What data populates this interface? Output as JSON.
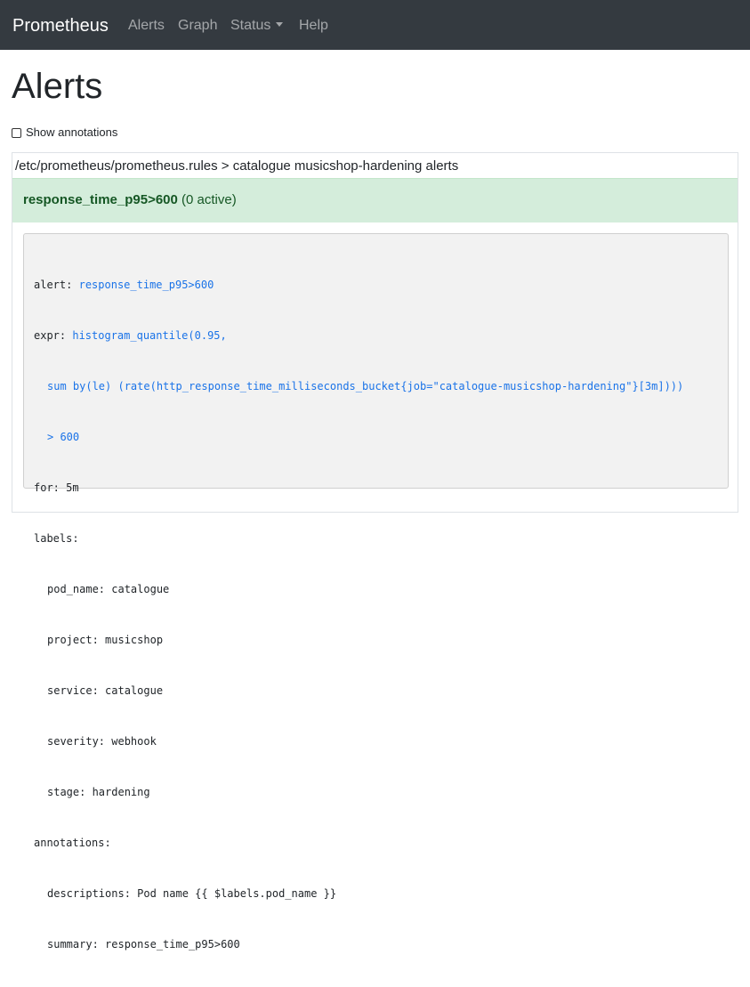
{
  "navbar": {
    "brand": "Prometheus",
    "items": [
      {
        "label": "Alerts"
      },
      {
        "label": "Graph"
      },
      {
        "label": "Status"
      },
      {
        "label": "Help"
      }
    ]
  },
  "page": {
    "title": "Alerts",
    "show_annotations_label": "Show annotations",
    "show_annotations_checked": false
  },
  "group": {
    "header": "/etc/prometheus/prometheus.rules > catalogue musicshop-hardening alerts",
    "alert": {
      "name": "response_time_p95>600",
      "status": "(0 active)",
      "status_color": "#d4eddb"
    },
    "rule": {
      "alert_key": "alert:",
      "alert_value": "response_time_p95>600",
      "expr_key": "expr:",
      "expr_line1": "histogram_quantile(0.95,",
      "expr_line2": "sum by(le) (rate(http_response_time_milliseconds_bucket{job=\"catalogue-musicshop-hardening\"}[3m])))",
      "expr_line3": "> 600",
      "for_line": "for: 5m",
      "labels_key": "labels:",
      "labels": [
        "pod_name: catalogue",
        "project: musicshop",
        "service: catalogue",
        "severity: webhook",
        "stage: hardening"
      ],
      "annotations_key": "annotations:",
      "annotations": [
        "descriptions: Pod name {{ $labels.pod_name }}",
        "summary: response_time_p95>600"
      ]
    }
  }
}
